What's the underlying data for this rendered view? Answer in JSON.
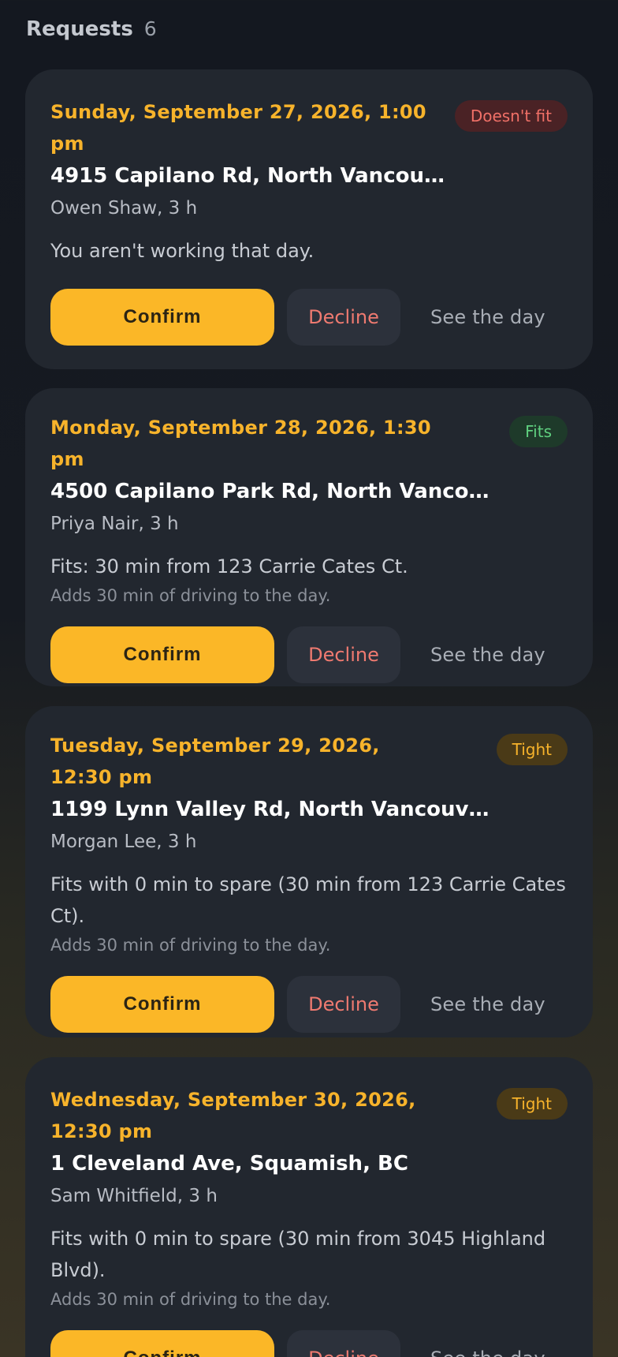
{
  "header": {
    "title": "Requests",
    "count": "6"
  },
  "requests": [
    {
      "date": "Sunday, September 27, 2026, 1:00 pm",
      "badge": "Doesn't fit",
      "address": "4915 Capilano Rd, North Vancou…",
      "client": "Owen Shaw, 3 h",
      "fit_text": "You aren't working that day.",
      "confirm_label": "Confirm",
      "decline_label": "Decline",
      "see_label": "See the day"
    },
    {
      "date": "Monday, September 28, 2026, 1:30 pm",
      "badge": "Fits",
      "address": "4500 Capilano Park Rd, North Vancou…",
      "client": "Priya Nair, 3 h",
      "fit_text": "Fits: 30 min from 123 Carrie Cates Ct.",
      "drive_text": "Adds 30 min of driving to the day.",
      "confirm_label": "Confirm",
      "decline_label": "Decline",
      "see_label": "See the day"
    },
    {
      "date": "Tuesday, September 29, 2026, 12:30 pm",
      "badge": "Tight",
      "address": "1199 Lynn Valley Rd, North Vancouve…",
      "client": "Morgan Lee, 3 h",
      "fit_text": "Fits with 0 min to spare (30 min from 123 Carrie Cates Ct).",
      "drive_text": "Adds 30 min of driving to the day.",
      "confirm_label": "Confirm",
      "decline_label": "Decline",
      "see_label": "See the day"
    },
    {
      "date": "Wednesday, September 30, 2026, 12:30 pm",
      "badge": "Tight",
      "address": "1 Cleveland Ave, Squamish, BC",
      "client": "Sam Whitfield, 3 h",
      "fit_text": "Fits with 0 min to spare (30 min from 3045 Highland Blvd).",
      "drive_text": "Adds 30 min of driving to the day.",
      "confirm_label": "Confirm",
      "decline_label": "Decline",
      "see_label": "See the day"
    }
  ],
  "colors": {
    "accent": "#fbb727",
    "card_bg": "#22272f",
    "decline": "#ef7a70",
    "fits": "#5fcf7f",
    "doesnt_fit": "#f07067"
  }
}
